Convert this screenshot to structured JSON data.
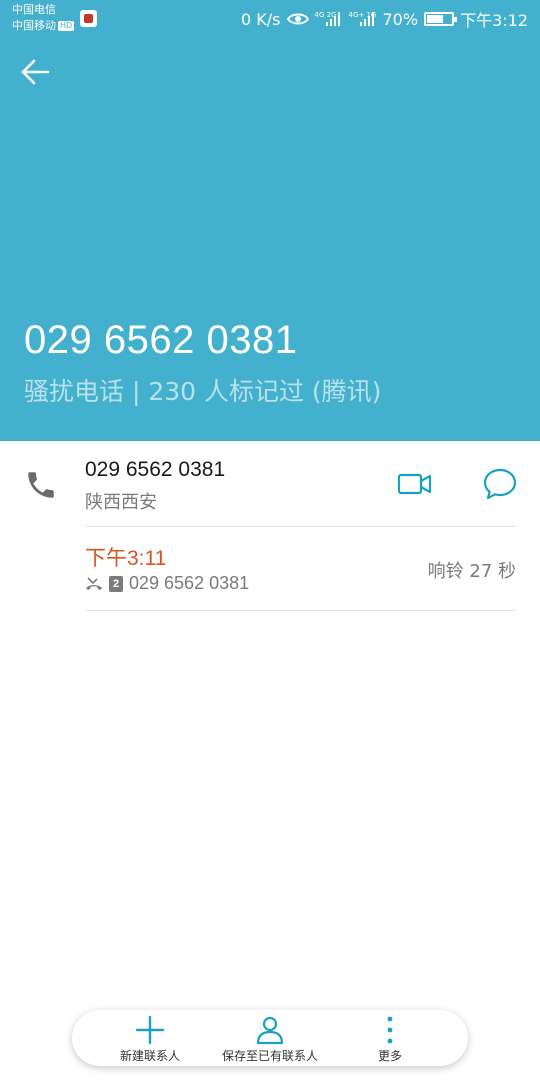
{
  "status_bar": {
    "carrier_1": "中国电信",
    "carrier_2": "中国移动",
    "hd_badge": "HD",
    "net_speed": "0 K/s",
    "signal_tag_1": "4G 2G",
    "signal_tag_2": "4G+ 1G",
    "battery": "70%",
    "battery_level_percent": 70,
    "time": "下午3:12"
  },
  "header": {
    "number": "029 6562 0381",
    "tag": "骚扰电话 | 230 人标记过 (腾讯)",
    "color": "#43b1cd"
  },
  "contact": {
    "number": "029 6562 0381",
    "location": "陕西西安",
    "accent_color": "#1ba1c0"
  },
  "call_log": {
    "time": "下午3:11",
    "sim": "2",
    "number": "029 6562 0381",
    "duration": "响铃 27 秒",
    "time_color": "#d9531e"
  },
  "bottom_bar": {
    "new_contact": "新建联系人",
    "save_existing": "保存至已有联系人",
    "more": "更多"
  },
  "icons": [
    "back-arrow-icon",
    "phone-icon",
    "video-call-icon",
    "message-icon",
    "missed-call-icon",
    "sim-2-icon",
    "plus-icon",
    "person-icon",
    "more-vertical-icon",
    "eye-icon",
    "signal-icon",
    "battery-icon"
  ]
}
